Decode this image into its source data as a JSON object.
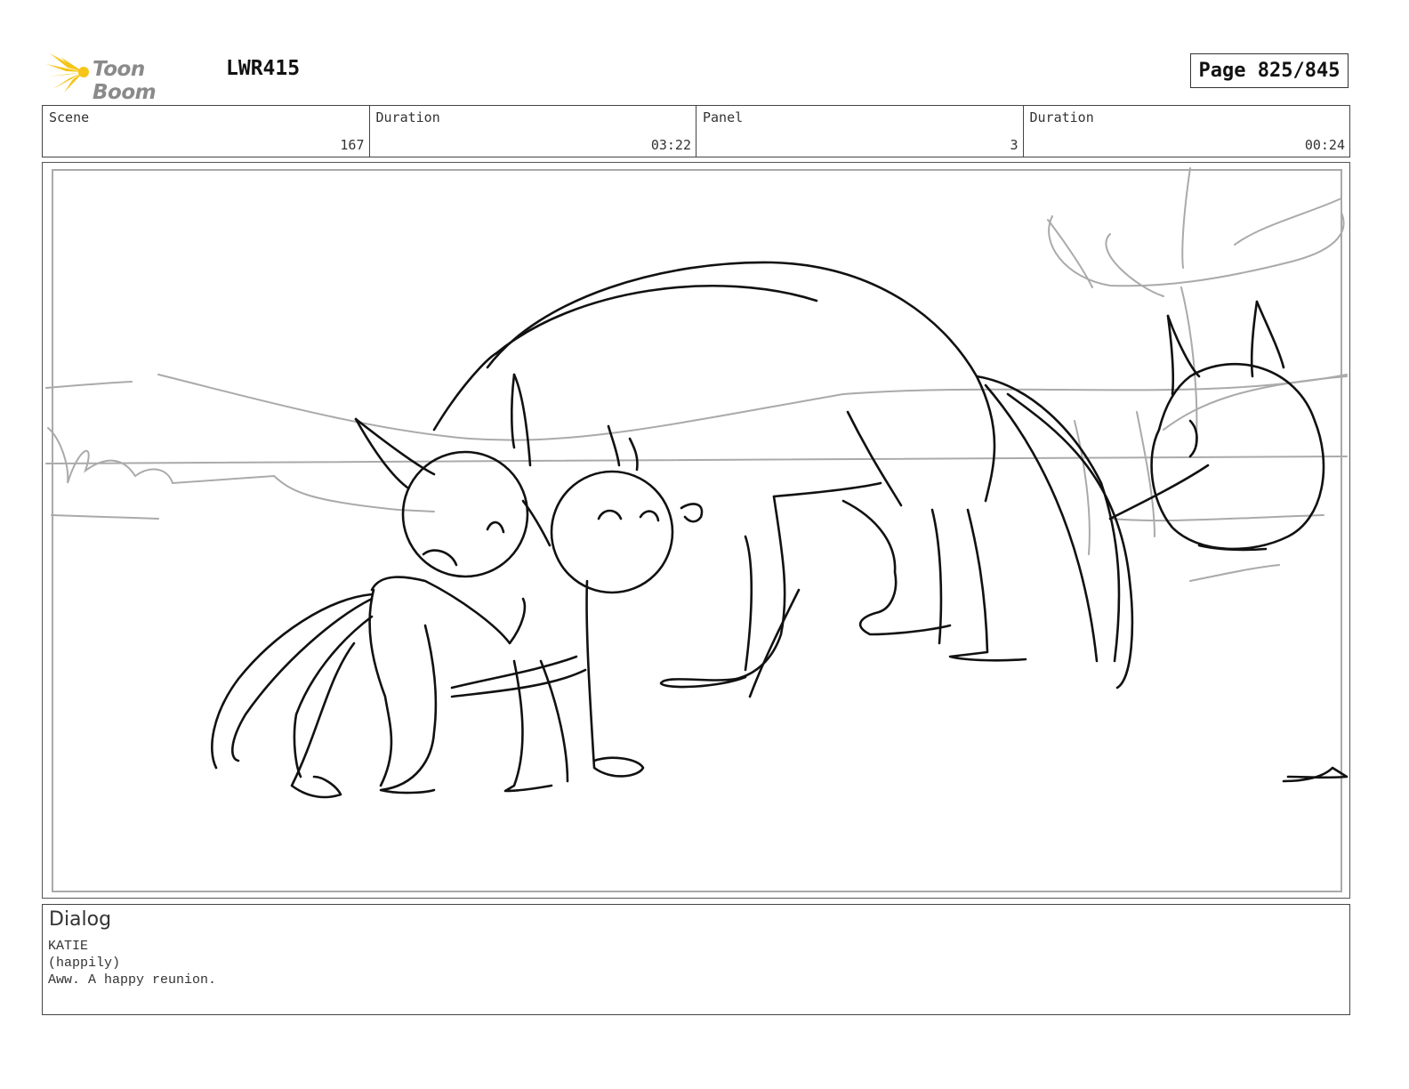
{
  "header": {
    "logo_text": "Toon Boom",
    "project_id": "LWR415",
    "page": "Page 825/845"
  },
  "info_bar": [
    {
      "label": "Scene",
      "value": "167"
    },
    {
      "label": "Duration",
      "value": "03:22"
    },
    {
      "label": "Panel",
      "value": "3"
    },
    {
      "label": "Duration",
      "value": "00:24"
    }
  ],
  "panel": {
    "drawing": "storyboard-sketch-cats"
  },
  "dialog": {
    "title": "Dialog",
    "character": "KATIE",
    "direction": "(happily)",
    "line": "Aww. A happy reunion."
  },
  "colors": {
    "ink": "#111111",
    "sketch_gray": "#aaaaaa",
    "logo_yellow": "#f5c518",
    "logo_text": "#8a8a8a"
  }
}
